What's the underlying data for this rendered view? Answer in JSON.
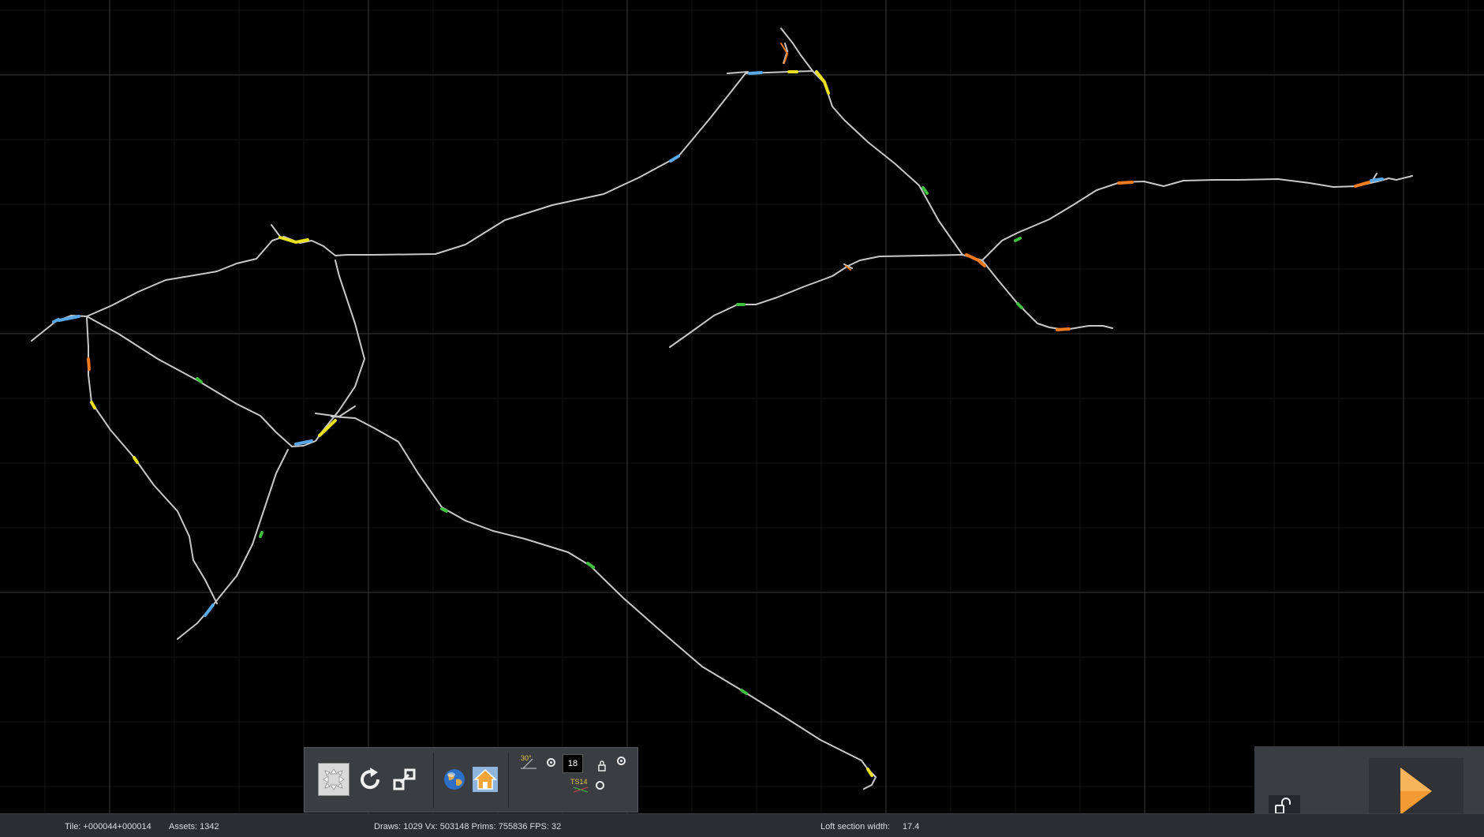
{
  "toolbar": {
    "buttons": [
      {
        "name": "fit-view-button",
        "icon": "fit-view-icon",
        "active": true
      },
      {
        "name": "rotate-view-button",
        "icon": "rotate-icon",
        "active": false
      },
      {
        "name": "resize-view-button",
        "icon": "resize-icon",
        "active": false
      },
      {
        "name": "world-view-button",
        "icon": "globe-icon",
        "active": false
      },
      {
        "name": "home-view-button",
        "icon": "home-icon",
        "active": false
      }
    ],
    "angle_label": "30°",
    "number_value": "18",
    "ts_label": "TS14"
  },
  "status": {
    "tile": "Tile: +000044+000014",
    "assets": "Assets: 1342",
    "render_stats": "Draws: 1029 Vx: 503148 Prims: 755836 FPS: 32",
    "loft_label": "Loft section width:",
    "loft_value": "17.4"
  },
  "colors": {
    "background": "#000000",
    "grid_minor": "#1a1a1a",
    "grid_major": "#3a3a3a",
    "track": "#c8c8c8",
    "marker_yellow": "#e8e020",
    "marker_orange": "#f07a20",
    "marker_blue": "#5aa8e8",
    "marker_green": "#40c040",
    "play_orange": "#f39a33"
  }
}
